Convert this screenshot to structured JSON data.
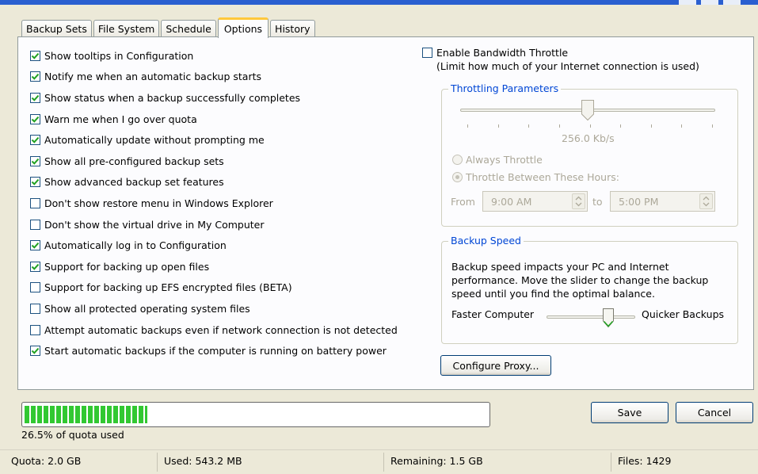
{
  "tabs": [
    {
      "label": "Backup Sets",
      "active": false
    },
    {
      "label": "File System",
      "active": false
    },
    {
      "label": "Schedule",
      "active": false
    },
    {
      "label": "Options",
      "active": true
    },
    {
      "label": "History",
      "active": false
    }
  ],
  "options": [
    {
      "label": "Show tooltips in Configuration",
      "checked": true
    },
    {
      "label": "Notify me when an automatic backup starts",
      "checked": true
    },
    {
      "label": "Show status when a backup successfully completes",
      "checked": true
    },
    {
      "label": "Warn me when I go over quota",
      "checked": true
    },
    {
      "label": "Automatically update without prompting me",
      "checked": true
    },
    {
      "label": "Show all pre-configured backup sets",
      "checked": true
    },
    {
      "label": "Show advanced backup set features",
      "checked": true
    },
    {
      "label": "Don't show restore menu in Windows Explorer",
      "checked": false
    },
    {
      "label": "Don't show the virtual drive in My Computer",
      "checked": false
    },
    {
      "label": "Automatically log in to Configuration",
      "checked": true
    },
    {
      "label": "Support for backing up open files",
      "checked": true
    },
    {
      "label": "Support for backing up EFS encrypted files (BETA)",
      "checked": false
    },
    {
      "label": "Show all protected operating system files",
      "checked": false
    },
    {
      "label": "Attempt automatic backups even if network connection is not detected",
      "checked": false
    },
    {
      "label": "Start automatic backups if the computer is running on battery power",
      "checked": true
    }
  ],
  "bandwidth": {
    "enable_label": "Enable Bandwidth Throttle",
    "enable_checked": false,
    "description": "(Limit how much of your Internet connection is used)",
    "params_legend": "Throttling Parameters",
    "rate": "256.0 Kb/s",
    "always_label": "Always Throttle",
    "between_label": "Throttle Between These Hours:",
    "from_label": "From",
    "from_value": "9:00 AM",
    "to_label": "to",
    "to_value": "5:00 PM"
  },
  "speed": {
    "legend": "Backup Speed",
    "description_lines": [
      "Backup speed impacts your PC and Internet",
      "performance. Move the slider to change the backup",
      "speed until you find the optimal balance."
    ],
    "left_label": "Faster Computer",
    "right_label": "Quicker Backups"
  },
  "buttons": {
    "proxy": "Configure Proxy...",
    "save": "Save",
    "cancel": "Cancel"
  },
  "quota": {
    "percent_used": 26.5,
    "text": "26.5% of quota used"
  },
  "status": {
    "quota": "Quota: 2.0 GB",
    "used": "Used: 543.2 MB",
    "remaining": "Remaining: 1.5 GB",
    "files": "Files: 1429"
  },
  "colors": {
    "accent_tab": "#ffc83c",
    "legend_blue": "#0046d5",
    "progress_green": "#32c832"
  }
}
